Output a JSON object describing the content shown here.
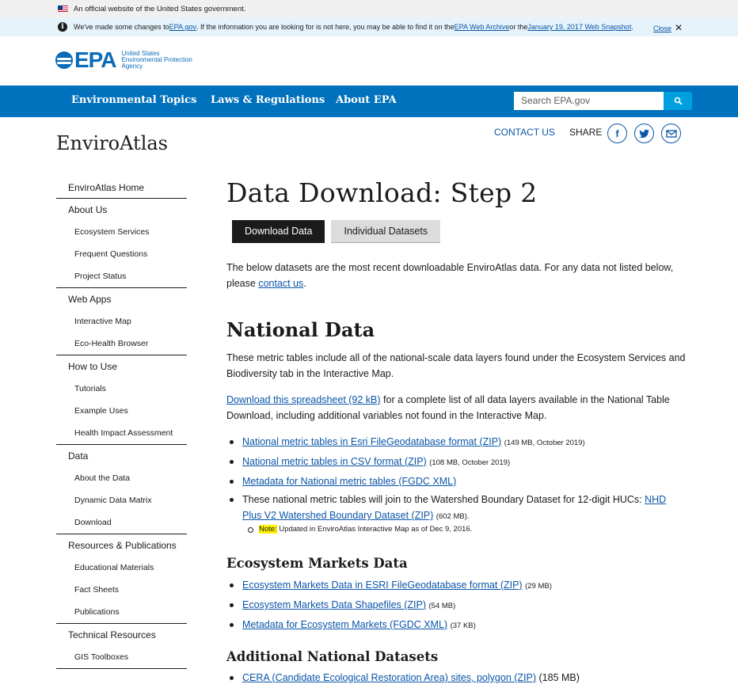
{
  "gov_banner": {
    "text": "An official website of the United States government."
  },
  "notice": {
    "text_1": "We've made some changes to ",
    "link_1": "EPA.gov",
    "text_2": ". If the information you are looking for is not here, you may be able to find it on the ",
    "link_2": "EPA Web Archive",
    "text_3": " or the ",
    "link_3": "January 19, 2017 Web Snapshot",
    "text_4": ".",
    "close_label": "Close"
  },
  "header": {
    "logo_text": "EPA",
    "logo_sub_1": "United States",
    "logo_sub_2": "Environmental Protection",
    "logo_sub_3": "Agency"
  },
  "nav": {
    "items": [
      "Environmental Topics",
      "Laws & Regulations",
      "About EPA"
    ],
    "search_placeholder": "Search EPA.gov",
    "search_icon": "magnifier-icon"
  },
  "site": {
    "title": "EnviroAtlas",
    "contact": "CONTACT US",
    "share": "SHARE"
  },
  "sidebar": {
    "home": "EnviroAtlas Home",
    "groups": [
      {
        "label": "About Us",
        "items": [
          "Ecosystem Services",
          "Frequent Questions",
          "Project Status"
        ]
      },
      {
        "label": "Web Apps",
        "items": [
          "Interactive Map",
          "Eco-Health Browser"
        ]
      },
      {
        "label": "How to Use",
        "items": [
          "Tutorials",
          "Example Uses",
          "Health Impact Assessment"
        ]
      },
      {
        "label": "Data",
        "items": [
          "About the Data",
          "Dynamic Data Matrix",
          "Download"
        ]
      },
      {
        "label": "Resources & Publications",
        "items": [
          "Educational Materials",
          "Fact Sheets",
          "Publications"
        ]
      },
      {
        "label": "Technical Resources",
        "items": [
          "GIS Toolboxes"
        ]
      }
    ]
  },
  "main": {
    "title": "Data Download: Step 2",
    "tabs": [
      "Download Data",
      "Individual Datasets"
    ],
    "intro_1": "The below datasets are the most recent downloadable EnviroAtlas data. For any data not listed below, please ",
    "intro_link": "contact us",
    "intro_2": ".",
    "national": {
      "heading": "National Data",
      "desc": "These metric tables include all of the national-scale data layers found under the Ecosystem Services and Biodiversity tab in the Interactive Map.",
      "spreadsheet_link": "Download this spreadsheet (92 kB)",
      "spreadsheet_text": " for a complete list of all data layers available in the National Table Download, including additional variables not found in the Interactive Map.",
      "items": [
        {
          "link": "National metric tables in Esri FileGeodatabase format (ZIP)",
          "meta": "(149 MB, October 2019)"
        },
        {
          "link": "National metric tables in CSV format (ZIP)",
          "meta": "(108 MB, October 2019)"
        },
        {
          "link": "Metadata for National metric tables (FGDC XML)",
          "meta": ""
        }
      ],
      "huc_text": "These national metric tables will join to the Watershed Boundary Dataset for 12-digit HUCs: ",
      "huc_link": "NHD Plus V2 Watershed Boundary Dataset (ZIP)",
      "huc_meta": "(602 MB).",
      "note_label": "Note:",
      "note_text": " Updated in EnviroAtlas Interactive Map as of Dec 9, 2016."
    },
    "markets": {
      "heading": "Ecosystem Markets Data",
      "items": [
        {
          "link": "Ecosystem Markets Data in ESRI FileGeodatabase format (ZIP)",
          "meta": "(29 MB)"
        },
        {
          "link": "Ecosystem Markets Data Shapefiles (ZIP)",
          "meta": "(54 MB)"
        },
        {
          "link": "Metadata for Ecosystem Markets (FGDC XML)",
          "meta": "(37 KB)"
        }
      ]
    },
    "additional": {
      "heading": "Additional National Datasets",
      "items": [
        {
          "link": "CERA (Candidate Ecological Restoration Area) sites, polygon (ZIP)",
          "meta": "(185 MB)"
        }
      ]
    }
  }
}
